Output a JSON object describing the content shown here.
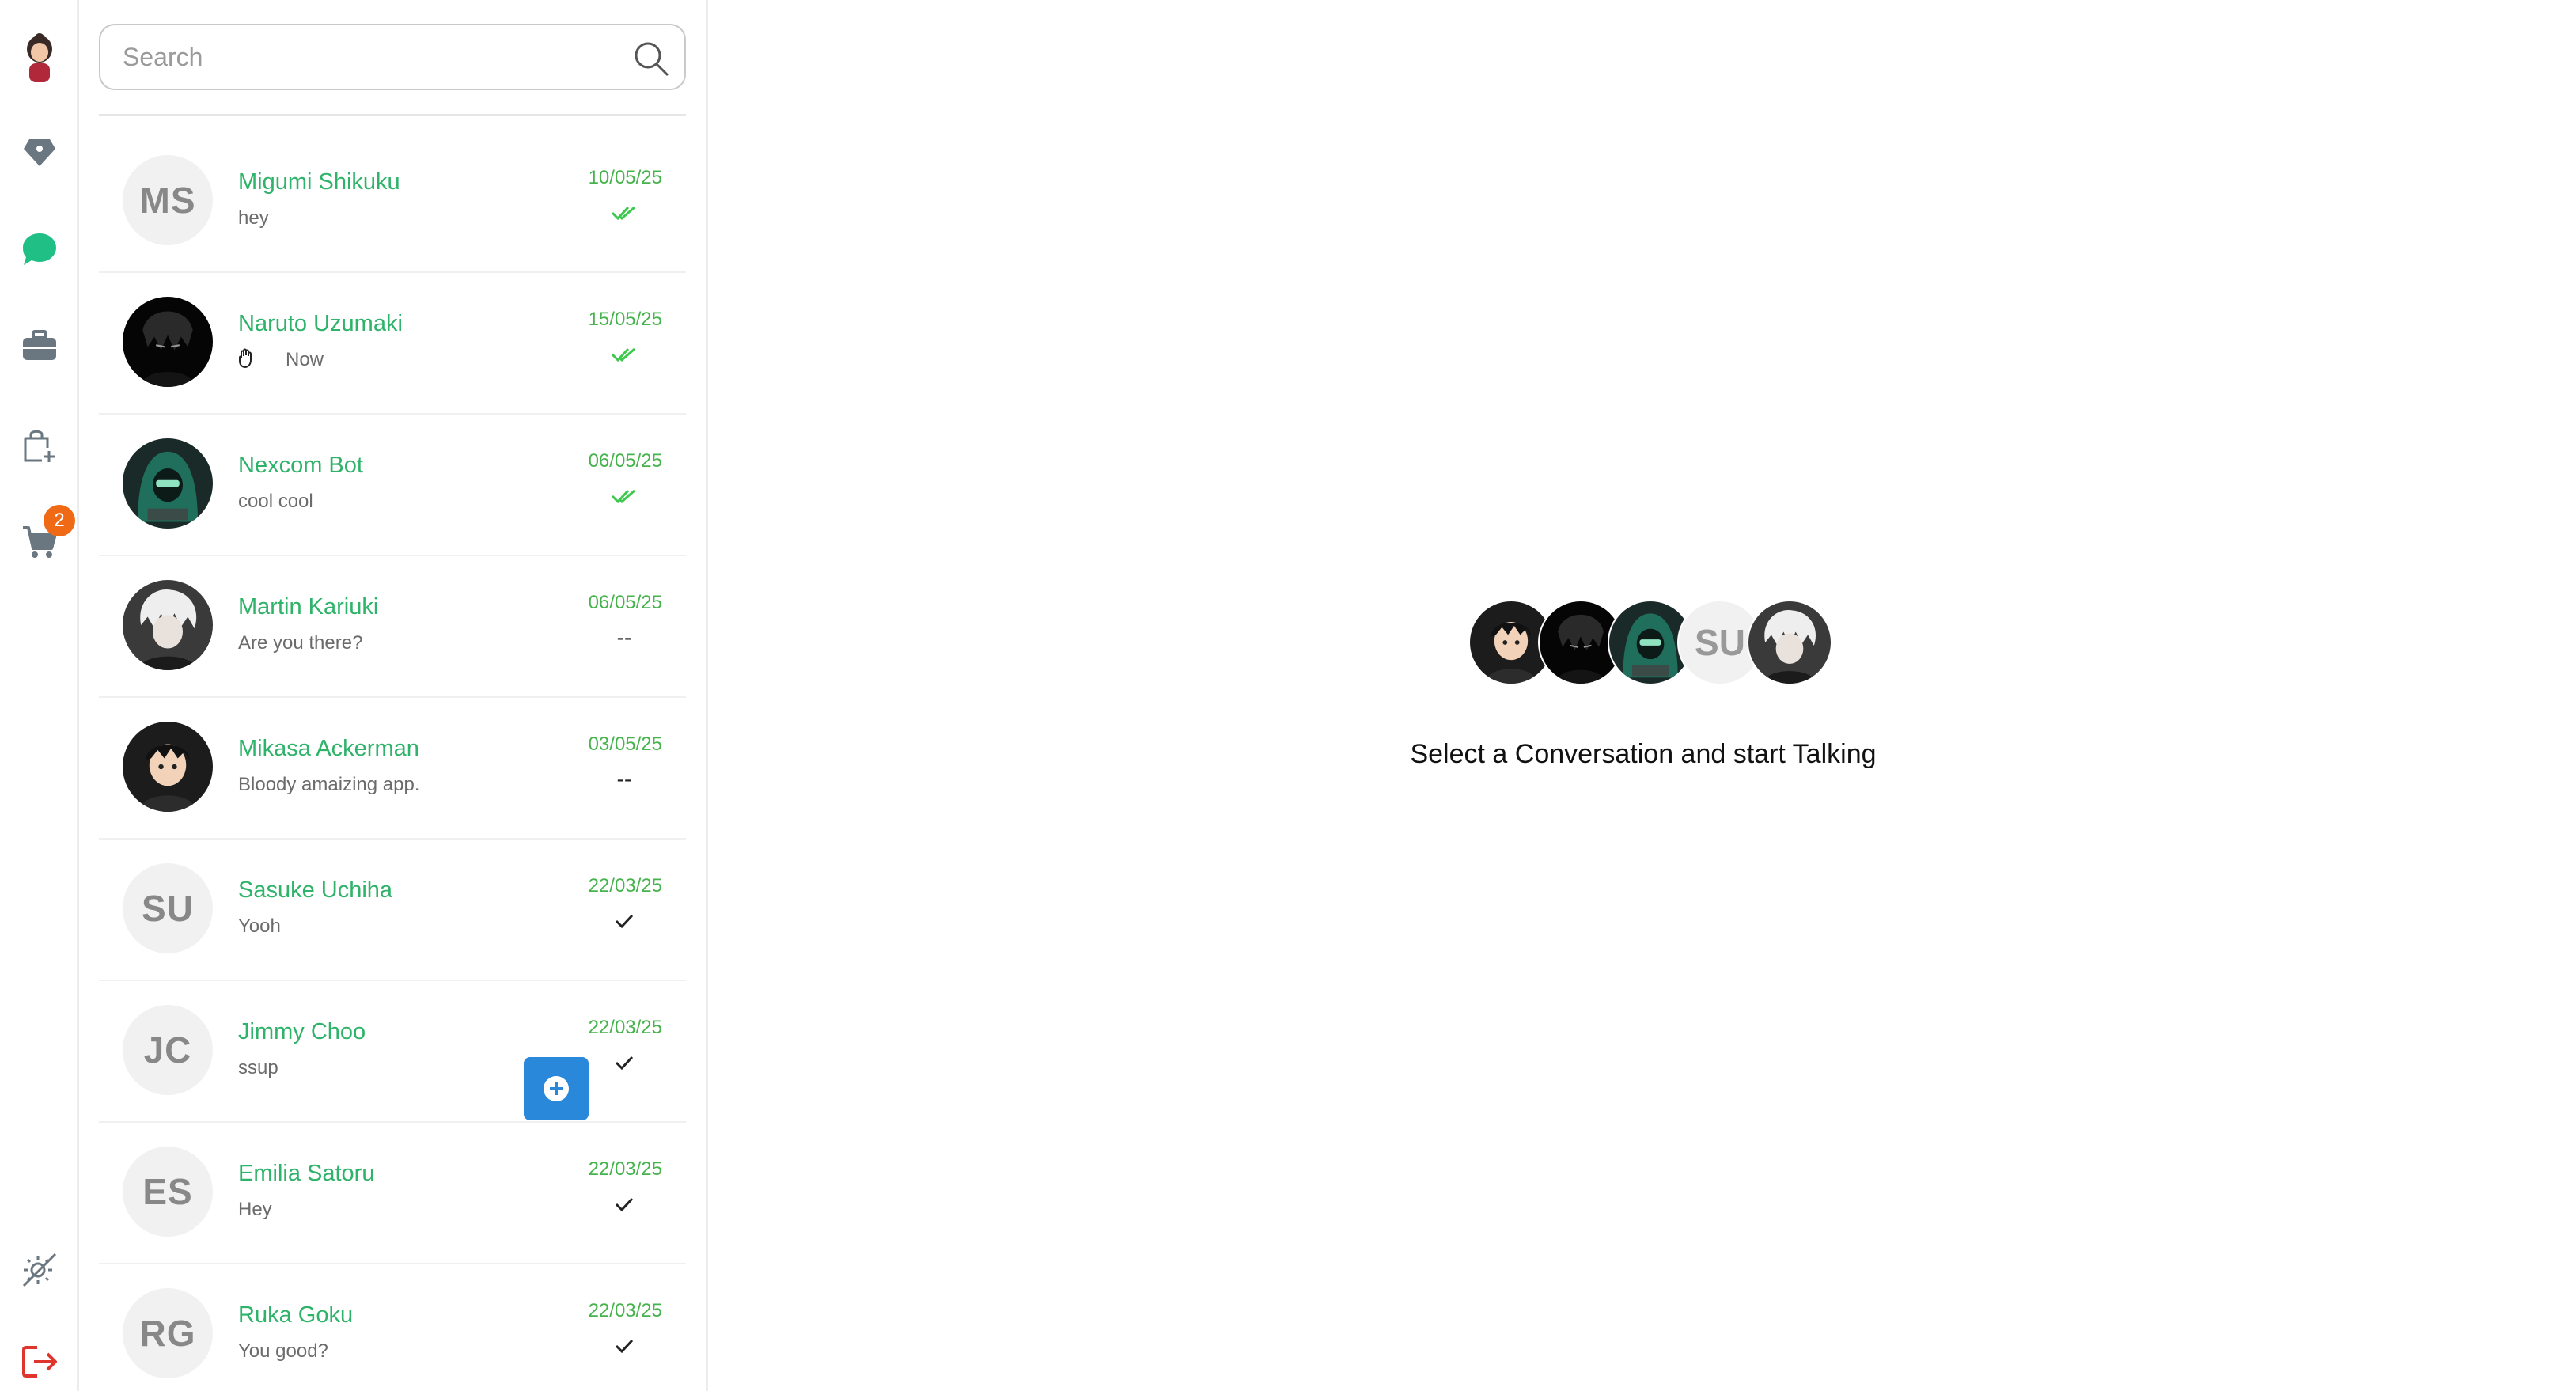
{
  "rail": {
    "cart_badge": "2"
  },
  "search": {
    "placeholder": "Search"
  },
  "conversations": [
    {
      "name": "Migumi Shikuku",
      "message": "hey",
      "date": "10/05/25",
      "status": "read",
      "avatar": {
        "type": "initials",
        "text": "MS"
      }
    },
    {
      "name": "Naruto Uzumaki",
      "message": "Now",
      "date": "15/05/25",
      "status": "read",
      "avatar": {
        "type": "image",
        "icon": "dark-hooded-avatar"
      }
    },
    {
      "name": "Nexcom Bot",
      "message": "cool cool",
      "date": "06/05/25",
      "status": "read",
      "avatar": {
        "type": "image",
        "icon": "green-hacker-avatar"
      }
    },
    {
      "name": "Martin Kariuki",
      "message": "Are you there?",
      "date": "06/05/25",
      "status": "--",
      "avatar": {
        "type": "image",
        "icon": "white-hair-avatar"
      }
    },
    {
      "name": "Mikasa Ackerman",
      "message": "Bloody amaizing app.",
      "date": "03/05/25",
      "status": "--",
      "avatar": {
        "type": "image",
        "icon": "anime-boy-avatar"
      }
    },
    {
      "name": "Sasuke Uchiha",
      "message": "Yooh",
      "date": "22/03/25",
      "status": "sent",
      "avatar": {
        "type": "initials",
        "text": "SU"
      }
    },
    {
      "name": "Jimmy Choo",
      "message": "ssup",
      "date": "22/03/25",
      "status": "sent",
      "avatar": {
        "type": "initials",
        "text": "JC"
      }
    },
    {
      "name": "Emilia Satoru",
      "message": "Hey",
      "date": "22/03/25",
      "status": "sent",
      "avatar": {
        "type": "initials",
        "text": "ES"
      }
    },
    {
      "name": "Ruka Goku",
      "message": "You good?",
      "date": "22/03/25",
      "status": "sent",
      "avatar": {
        "type": "initials",
        "text": "RG"
      }
    }
  ],
  "main": {
    "stack_initials": "SU",
    "empty_text": "Select a Conversation and start Talking"
  },
  "colors": {
    "accent_green": "#2fb36a",
    "date_green": "#46b34d",
    "read_check": "#3cc94e",
    "badge_orange": "#f06a16",
    "float_button_blue": "#2a88db",
    "logout_red": "#e0342f"
  }
}
